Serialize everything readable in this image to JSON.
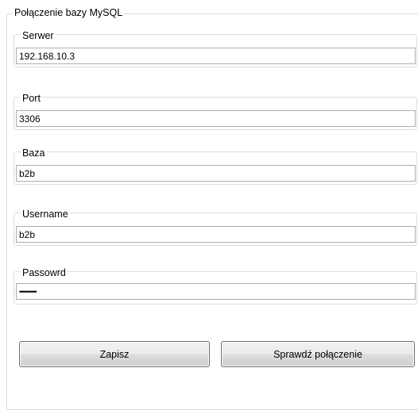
{
  "group": {
    "title": "Połączenie bazy MySQL"
  },
  "fields": [
    {
      "label": "Serwer",
      "value": "192.168.10.3"
    },
    {
      "label": "Port",
      "value": "3306"
    },
    {
      "label": "Baza",
      "value": "b2b"
    },
    {
      "label": "Username",
      "value": "b2b"
    },
    {
      "label": "Passowrd",
      "value": "••••••••••"
    }
  ],
  "buttons": {
    "save": "Zapisz",
    "test": "Sprawdź połączenie"
  }
}
